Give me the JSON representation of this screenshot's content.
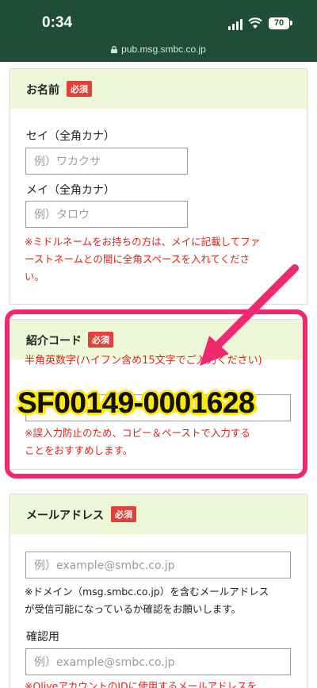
{
  "status_bar": {
    "time": "0:34",
    "battery": "70",
    "url": "pub.msg.smbc.co.jp"
  },
  "name_section": {
    "title": "お名前",
    "required": "必須",
    "sei_label": "セイ（全角カナ）",
    "sei_placeholder": "例）ワカクサ",
    "mei_label": "メイ（全角カナ）",
    "mei_placeholder": "例）タロウ",
    "note_line1": "※ミドルネームをお持ちの方は、メイに記載してファ",
    "note_line2": "ーストネームとの間に全角スペースを入れてくださ",
    "note_line3": "い。"
  },
  "referral_section": {
    "title": "紹介コード",
    "required": "必須",
    "instruction": "半角英数字(ハイフン含め15文字でご入力ください)",
    "code": "SF00149-0001628",
    "note_line1": "※誤入力防止のため、コピー＆ペーストで入力する",
    "note_line2": "ことをおすすめします。"
  },
  "email_section": {
    "title": "メールアドレス",
    "required": "必須",
    "email_placeholder": "例）example@smbc.co.jp",
    "note_line1": "※ドメイン（msg.smbc.co.jp）を含むメールアドレス",
    "note_line2": "が受信可能になっているか確認をお願いします。",
    "confirm_label": "確認用",
    "confirm_placeholder": "例）example@smbc.co.jp",
    "bottom_note": "※OliveアカウントのIDに使用するメールアドレスを"
  },
  "colors": {
    "status_bg": "#1f4d38",
    "section_head_bg": "#eef6d8",
    "required_badge": "#e0413a",
    "highlight": "#f02870",
    "code_outline": "#ffe800",
    "red_text": "#d8261d"
  },
  "icons": [
    "signal-icon",
    "wifi-icon",
    "battery-icon",
    "lock-icon",
    "arrow-annotation"
  ]
}
